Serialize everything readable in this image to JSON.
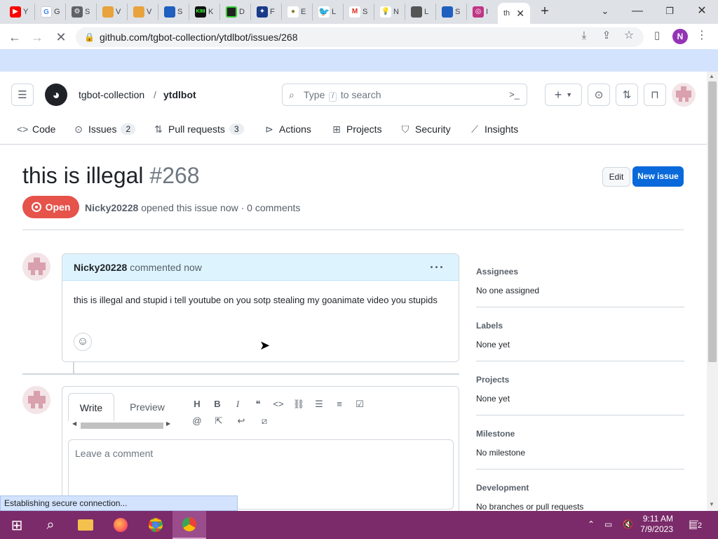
{
  "browser": {
    "tabs": [
      {
        "label": "Y",
        "icon": "youtube-icon",
        "color": "#ff0000"
      },
      {
        "label": "G",
        "icon": "google-icon",
        "color": "#4285f4"
      },
      {
        "label": "S",
        "icon": "settings-icon",
        "color": "#5f6368"
      },
      {
        "label": "V",
        "icon": "folder-icon",
        "color": "#e8a33d"
      },
      {
        "label": "V",
        "icon": "folder-icon",
        "color": "#e8a33d"
      },
      {
        "label": "S",
        "icon": "sonic-icon",
        "color": "#1f5fbf"
      },
      {
        "label": "K",
        "icon": "kim-icon",
        "color": "#111111"
      },
      {
        "label": "D",
        "icon": "grid-icon",
        "color": "#222222"
      },
      {
        "label": "F",
        "icon": "star-game-icon",
        "color": "#1a3a8a"
      },
      {
        "label": "E",
        "icon": "dot-icon",
        "color": "#8a7a2a"
      },
      {
        "label": "L",
        "icon": "twitter-icon",
        "color": "#1d9bf0"
      },
      {
        "label": "S",
        "icon": "gmail-icon",
        "color": "#d93025"
      },
      {
        "label": "N",
        "icon": "bulb-icon",
        "color": "#f2c94c"
      },
      {
        "label": "L",
        "icon": "mascot-icon",
        "color": "#555555"
      },
      {
        "label": "S",
        "icon": "sonic-icon",
        "color": "#1f5fbf"
      },
      {
        "label": "I",
        "icon": "instagram-icon",
        "color": "#c13584"
      }
    ],
    "active_tab": {
      "label": "th"
    },
    "url": "github.com/tgbot-collection/ytdlbot/issues/268",
    "profile_initial": "N",
    "status_text": "Establishing secure connection..."
  },
  "header": {
    "owner": "tgbot-collection",
    "separator": "/",
    "repo": "ytdlbot",
    "search_prefix": "Type",
    "search_key": "/",
    "search_suffix": "to search"
  },
  "repo_nav": [
    {
      "label": "Code",
      "icon": "code-icon",
      "count": ""
    },
    {
      "label": "Issues",
      "icon": "issue-icon",
      "count": "2"
    },
    {
      "label": "Pull requests",
      "icon": "pull-request-icon",
      "count": "3"
    },
    {
      "label": "Actions",
      "icon": "play-icon",
      "count": ""
    },
    {
      "label": "Projects",
      "icon": "table-icon",
      "count": ""
    },
    {
      "label": "Security",
      "icon": "shield-icon",
      "count": ""
    },
    {
      "label": "Insights",
      "icon": "graph-icon",
      "count": ""
    }
  ],
  "issue": {
    "title": "this is illegal",
    "number": "#268",
    "state": "Open",
    "author": "Nicky20228",
    "meta": "opened this issue now · 0 comments",
    "edit_label": "Edit",
    "new_issue_label": "New issue"
  },
  "comment": {
    "author": "Nicky20228",
    "action": "commented now",
    "body": "this is illegal and stupid i tell youtube on you sotp stealing my goanimate video you stupids"
  },
  "editor": {
    "write_tab": "Write",
    "preview_tab": "Preview",
    "placeholder": "Leave a comment"
  },
  "sidebar": [
    {
      "heading": "Assignees",
      "value": "No one assigned"
    },
    {
      "heading": "Labels",
      "value": "None yet"
    },
    {
      "heading": "Projects",
      "value": "None yet"
    },
    {
      "heading": "Milestone",
      "value": "No milestone"
    },
    {
      "heading": "Development",
      "value": "No branches or pull requests"
    }
  ],
  "taskbar": {
    "time": "9:11 AM",
    "date": "7/9/2023",
    "notifications": "2"
  },
  "colors": {
    "accent": "#0969da",
    "open_state": "#e5534b",
    "taskbar": "#7b2b6a"
  }
}
